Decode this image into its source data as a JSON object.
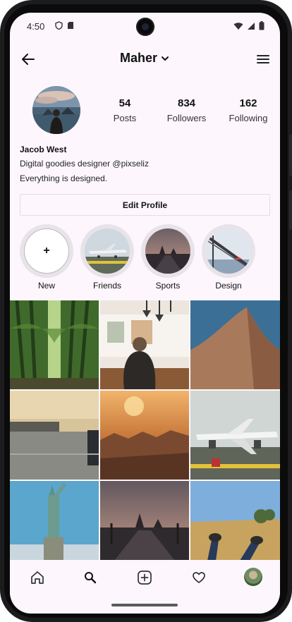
{
  "status_bar": {
    "time": "4:50"
  },
  "app_bar": {
    "username": "Maher"
  },
  "profile": {
    "name": "Jacob West",
    "bio_line1": "Digital goodies designer @pixseliz",
    "bio_line2": "Everything is designed.",
    "stats": [
      {
        "value": "54",
        "label": "Posts"
      },
      {
        "value": "834",
        "label": "Followers"
      },
      {
        "value": "162",
        "label": "Following"
      }
    ],
    "edit_button": "Edit Profile"
  },
  "highlights": [
    {
      "label": "New",
      "symbol": "+"
    },
    {
      "label": "Friends"
    },
    {
      "label": "Sports"
    },
    {
      "label": "Design"
    }
  ],
  "icons": {
    "back": "arrow-left-icon",
    "menu": "hamburger-menu-icon",
    "dropdown": "chevron-down-icon",
    "nav": [
      "home-icon",
      "search-icon",
      "add-post-icon",
      "heart-icon",
      "profile-avatar"
    ]
  },
  "colors": {
    "background": "#fdf7fd",
    "text": "#111111",
    "border": "#e3dde3"
  }
}
